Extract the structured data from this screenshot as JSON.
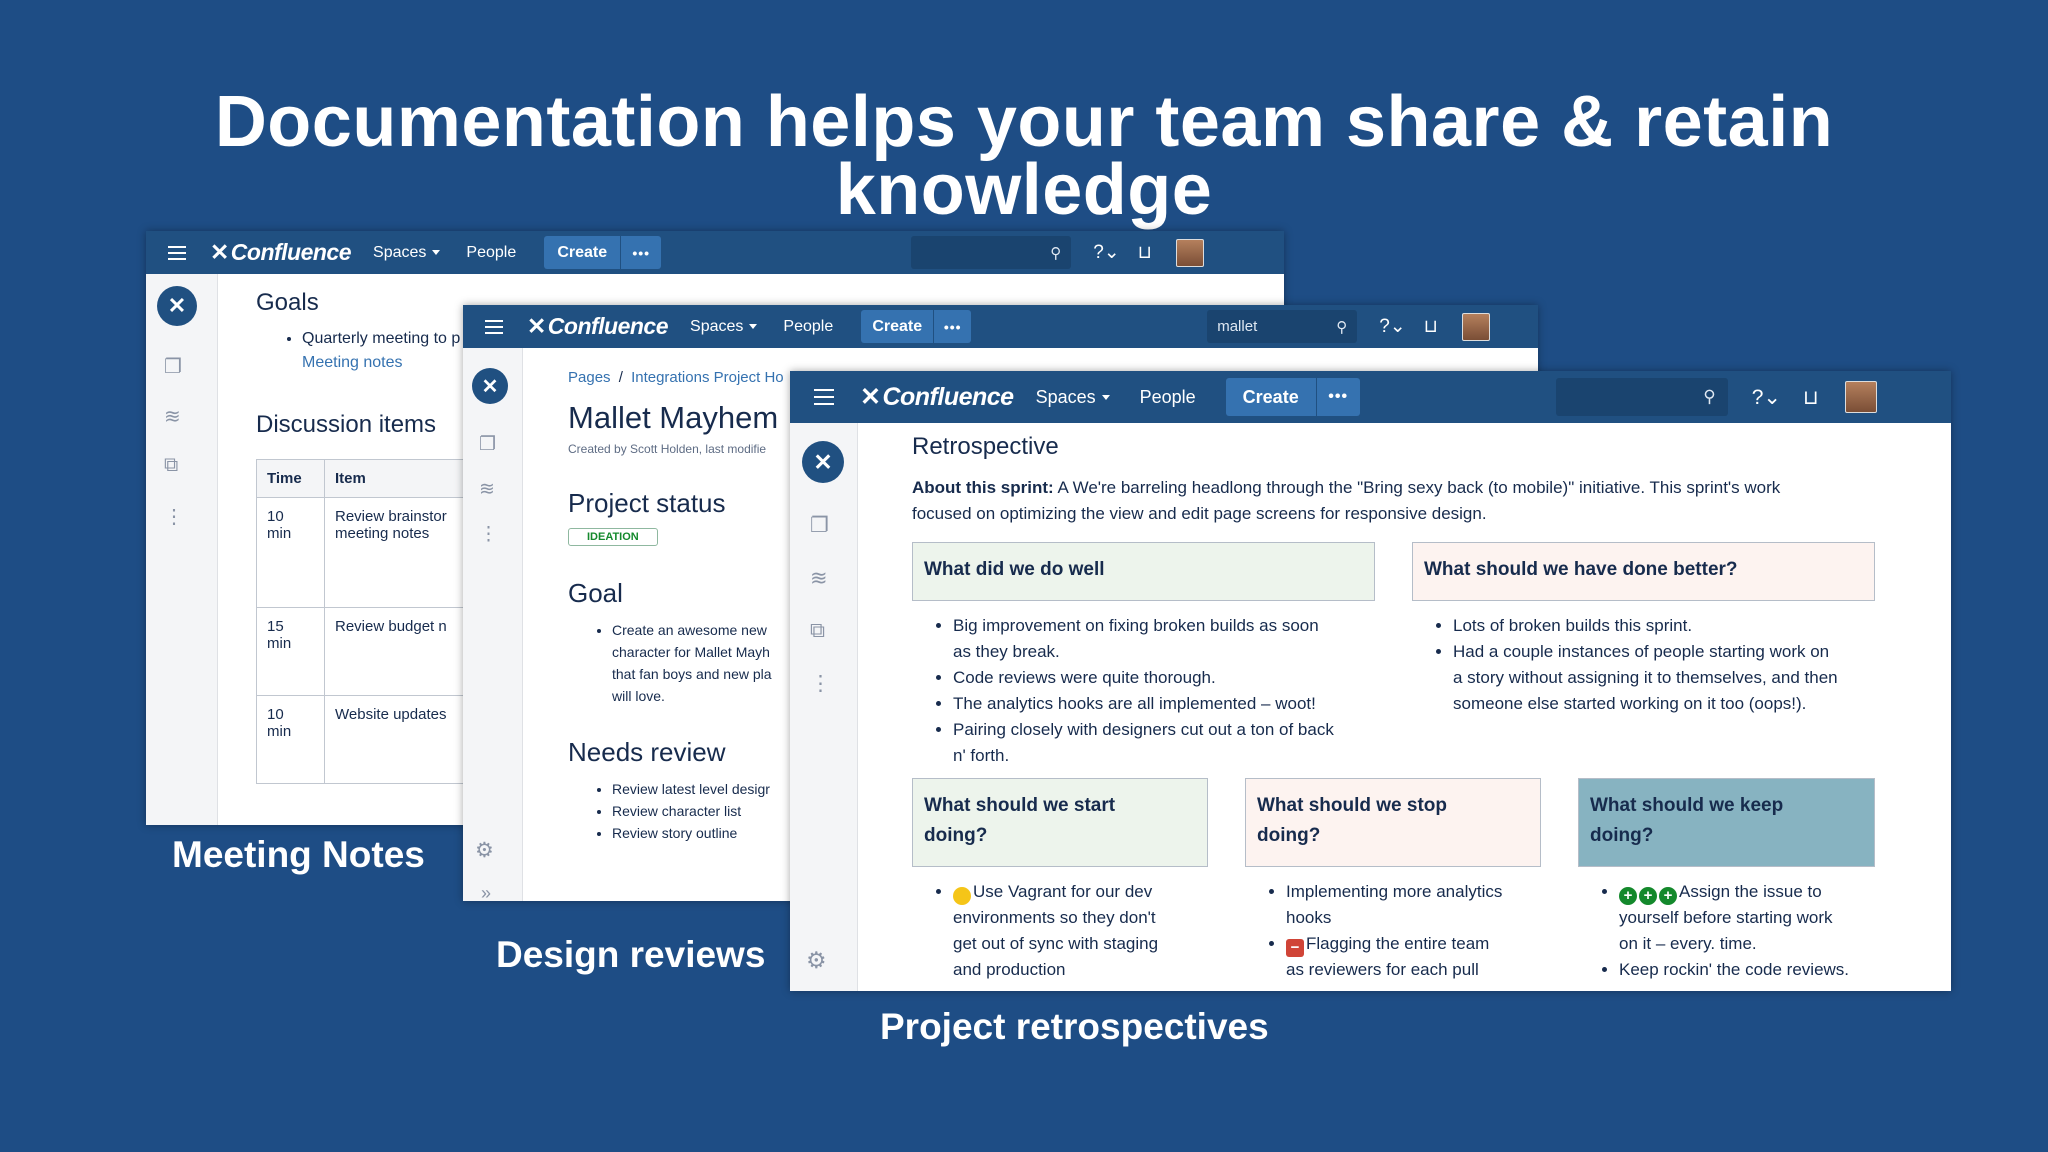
{
  "slide": {
    "title_line1": "Documentation helps your team share & retain",
    "title_line2": "knowledge",
    "captions": {
      "meeting": "Meeting Notes",
      "design": "Design reviews",
      "retro": "Project retrospectives"
    }
  },
  "colors": {
    "background": "#1e4d85",
    "navbar": "#205081",
    "create_button": "#3572b0",
    "panel_green": "#edf4ec",
    "panel_red": "#fdf3f0",
    "panel_blue": "#87b3c1"
  },
  "nav": {
    "logo": "Confluence",
    "spaces": "Spaces",
    "people": "People",
    "create": "Create",
    "more": "•••"
  },
  "meeting_notes": {
    "goals_heading": "Goals",
    "goal_item": "Quarterly meeting to p",
    "goal_link": "Meeting notes",
    "discussion_heading": "Discussion items",
    "table": {
      "headers": [
        "Time",
        "Item"
      ],
      "rows": [
        {
          "time_line1": "10",
          "time_line2": "min",
          "item_line1": "Review brainstor",
          "item_line2": "meeting notes"
        },
        {
          "time_line1": "15",
          "time_line2": "min",
          "item_line1": "Review budget n",
          "item_line2": ""
        },
        {
          "time_line1": "10",
          "time_line2": "min",
          "item_line1": "Website updates",
          "item_line2": ""
        }
      ]
    }
  },
  "design_review": {
    "search_value": "mallet",
    "breadcrumb": {
      "pages": "Pages",
      "separator": "/",
      "parent": "Integrations Project Ho"
    },
    "page_title": "Mallet Mayhem",
    "byline": "Created by Scott Holden, last modifie",
    "status_heading": "Project status",
    "status_lozenge": "IDEATION",
    "goal_heading": "Goal",
    "goal_lines": [
      "Create an awesome new",
      "character for Mallet Mayh",
      "that fan boys and new pla",
      "will love."
    ],
    "needs_review_heading": "Needs review",
    "review_items": [
      "Review latest level desigr",
      "Review character list",
      "Review story outline"
    ]
  },
  "retro": {
    "page_title": "Retrospective",
    "about_label": "About this sprint:",
    "about_line1": "A We're barreling headlong through the \"Bring sexy back (to mobile)\" initiative. This sprint's work",
    "about_line2": "focused on optimizing the view and edit page screens for responsive design.",
    "did_well": {
      "title": "What did we do well",
      "items": [
        {
          "l1": "Big improvement on fixing broken builds as soon",
          "l2": "as they break."
        },
        {
          "l1": "Code reviews were quite thorough.",
          "l2": ""
        },
        {
          "l1": "The analytics hooks are all implemented – woot!",
          "l2": ""
        },
        {
          "l1": "Pairing closely with designers cut out a ton of back",
          "l2": "n' forth."
        }
      ]
    },
    "done_better": {
      "title": "What should we have done better?",
      "items": [
        {
          "l1": "Lots of broken builds this sprint.",
          "l2": "",
          "l3": ""
        },
        {
          "l1": "Had a couple instances of people starting work on",
          "l2": "a story without assigning it to themselves, and then",
          "l3": "someone else started working on it too (oops!)."
        }
      ]
    },
    "start": {
      "title_l1": "What should we start",
      "title_l2": "doing?",
      "items": [
        {
          "l1": "Use Vagrant for our dev",
          "l2": "environments so they don't",
          "l3": "get out of sync with staging",
          "l4": "and production"
        }
      ]
    },
    "stop": {
      "title_l1": "What should we stop",
      "title_l2": "doing?",
      "items": [
        {
          "l1": "Implementing more analytics",
          "l2": "hooks"
        },
        {
          "l1": "Flagging the entire team",
          "l2": "as reviewers for each pull"
        }
      ]
    },
    "keep": {
      "title_l1": "What should we keep",
      "title_l2": "doing?",
      "items": [
        {
          "l1": "Assign the issue to",
          "l2": "yourself before starting work",
          "l3": "on it – every. time."
        },
        {
          "l1": "Keep rockin' the code reviews.",
          "l2": "",
          "l3": ""
        }
      ]
    }
  }
}
